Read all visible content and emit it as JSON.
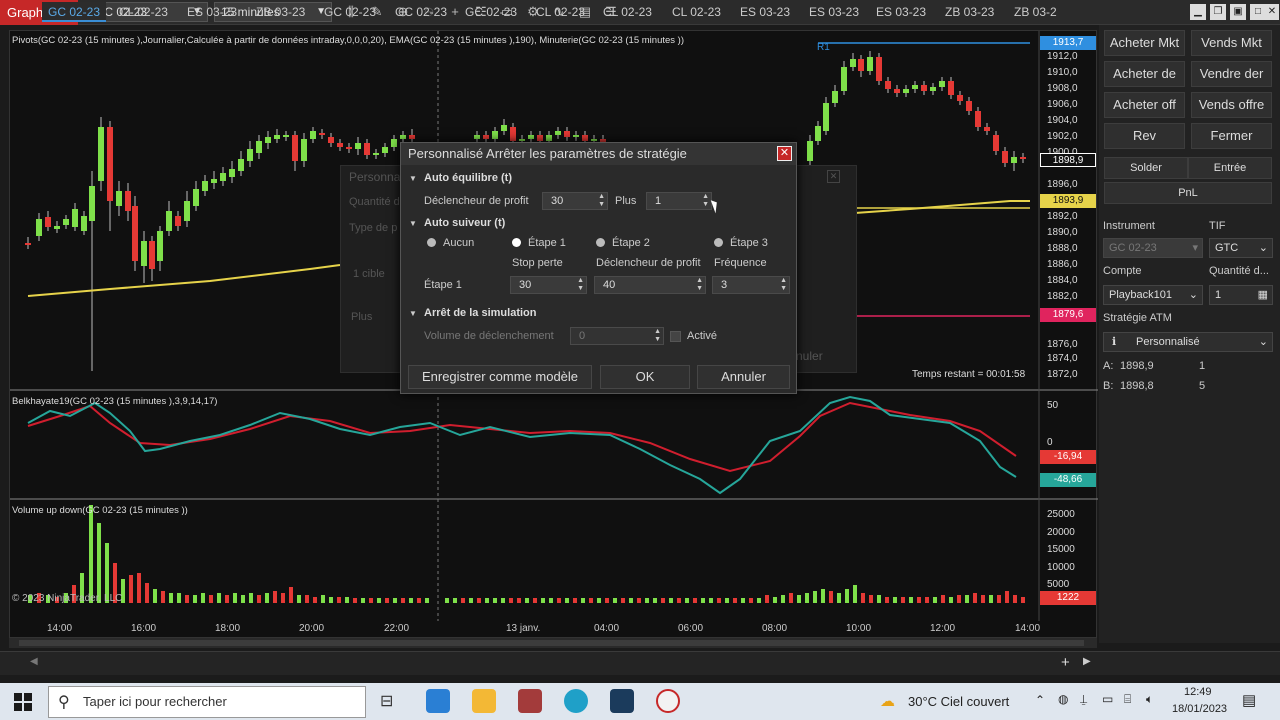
{
  "app": {
    "title": "Graphique",
    "instrument": "GC 02-23",
    "interval": "15 minutes"
  },
  "price_panel": {
    "indicator_line": "Pivots(GC 02-23 (15 minutes ),Journalier,Calculée à partir de données intraday,0,0,0,20), EMA(GC 02-23 (15 minutes ),190), Minuterie(GC 02-23 (15 minutes ))",
    "r1_label": "R1",
    "time_remaining": "Temps restant = 00:01:58",
    "watermark": "© 2023 NinjaTrader, LLC",
    "axis_ticks": [
      "1912,0",
      "1910,0",
      "1908,0",
      "1906,0",
      "1904,0",
      "1902,0",
      "1900,0",
      "1896,0",
      "1894,0",
      "1892,0",
      "1890,0",
      "1888,0",
      "1886,0",
      "1884,0",
      "1882,0",
      "1880,0",
      "1876,0",
      "1874,0",
      "1872,0"
    ],
    "tags": {
      "r1": "1913,7",
      "last": "1898,9",
      "ema": "1893,9",
      "pivot": "1879,6"
    },
    "colors": {
      "up": "#7fe04a",
      "down": "#e53935",
      "ema": "#e6d34a",
      "r1": "#2f8fe0",
      "pivot": "#e0245e"
    }
  },
  "oscillator_panel": {
    "title": "Belkhayate19(GC 02-23 (15 minutes ),3,9,14,17)",
    "axis_ticks": [
      "50",
      "0"
    ],
    "tags": {
      "red": "-16,94",
      "teal": "-48,66"
    }
  },
  "volume_panel": {
    "title": "Volume up down(GC 02-23 (15 minutes ))",
    "axis_ticks": [
      "25000",
      "20000",
      "15000",
      "10000",
      "5000"
    ],
    "tag": "1222"
  },
  "time_axis": [
    "14:00",
    "16:00",
    "18:00",
    "20:00",
    "22:00",
    "13 janv.",
    "04:00",
    "06:00",
    "08:00",
    "10:00",
    "12:00",
    "14:00"
  ],
  "right_panel": {
    "buttons": [
      "Acheter Mkt",
      "Vends Mkt",
      "Acheter de",
      "Vendre der",
      "Acheter off",
      "Vends offre",
      "Rev",
      "Fermer"
    ],
    "solder": "Solder",
    "entree": "Entrée",
    "pnl": "PnL",
    "instrument_label": "Instrument",
    "instrument_value": "GC 02-23",
    "tif_label": "TIF",
    "tif_value": "GTC",
    "compte_label": "Compte",
    "compte_value": "Playback101",
    "quantite_label": "Quantité d...",
    "quantite_value": "1",
    "strategie_label": "Stratégie ATM",
    "strategie_value": "Personnalisé",
    "ask_label": "A:",
    "ask_price": "1898,9",
    "ask_size": "1",
    "bid_label": "B:",
    "bid_price": "1898,8",
    "bid_size": "5"
  },
  "ghost_dialog": {
    "title": "Personna",
    "row1": "Quantité d",
    "row2": "Type de p",
    "row3": "1 cible",
    "row4": "Plus",
    "button": "nuler"
  },
  "dialog": {
    "title": "Personnalisé Arrêter les paramètres de stratégie",
    "auto_equilibre": "Auto équilibre (t)",
    "declencheur_label": "Déclencheur de profit",
    "declencheur_value": "30",
    "plus_label": "Plus",
    "plus_value": "1",
    "auto_suiveur": "Auto suiveur (t)",
    "radio_aucun": "Aucun",
    "radio_etape1": "Étape 1",
    "radio_etape2": "Étape 2",
    "radio_etape3": "Étape 3",
    "col_stop": "Stop perte",
    "col_declencheur": "Déclencheur de profit",
    "col_frequence": "Fréquence",
    "etape1_label": "Étape 1",
    "etape1_stop": "30",
    "etape1_declencheur": "40",
    "etape1_frequence": "3",
    "arret_simulation": "Arrêt de la simulation",
    "volume_label": "Volume de déclenchement",
    "volume_value": "0",
    "active_label": "Activé",
    "btn_save": "Enregistrer comme modèle",
    "btn_ok": "OK",
    "btn_cancel": "Annuler"
  },
  "tabs": [
    "GC 02-23",
    "CL 02-23",
    "ES 03-23",
    "ZB 03-23",
    "GC 02-23",
    "GC 02-23",
    "GC 02-23",
    "CL 02-23",
    "CL 02-23",
    "CL 02-23",
    "ES 03-23",
    "ES 03-23",
    "ES 03-23",
    "ZB 03-23",
    "ZB 03-2"
  ],
  "taskbar": {
    "search_placeholder": "Taper ici pour rechercher",
    "weather": "30°C  Ciel couvert",
    "time": "12:49",
    "date": "18/01/2023"
  }
}
